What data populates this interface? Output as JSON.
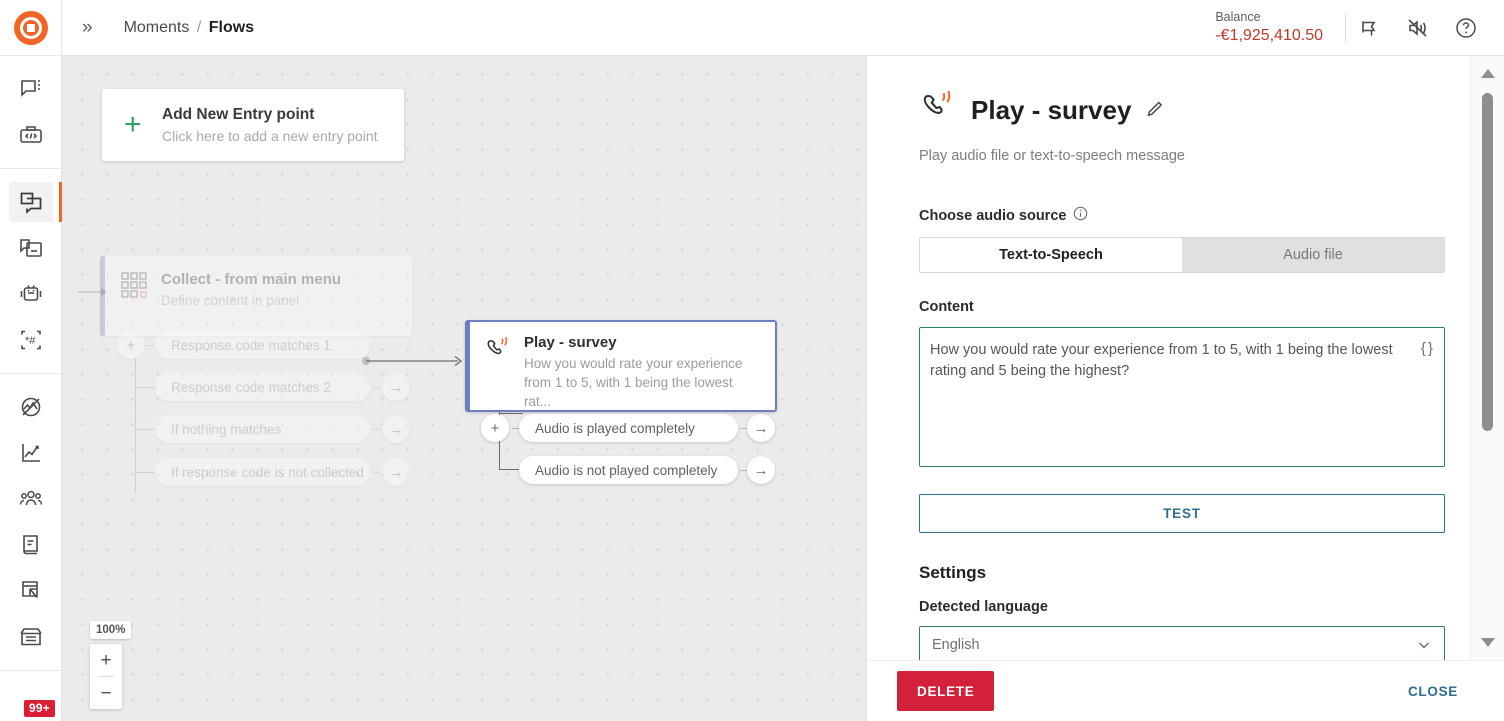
{
  "topbar": {
    "expand_icon": "chevron-double-right-icon",
    "breadcrumb_root": "Moments",
    "breadcrumb_sep": "/",
    "breadcrumb_current": "Flows",
    "balance_label": "Balance",
    "balance_value": "-€1,925,410.50",
    "balance_color": "#c0392b",
    "icons": [
      "announcement-icon",
      "mute-icon",
      "help-icon"
    ]
  },
  "rail": {
    "logo": "logo-icon",
    "groups": [
      {
        "items": [
          {
            "name": "conversations-icon",
            "active": false
          },
          {
            "name": "code-toolbox-icon",
            "active": false
          }
        ]
      },
      {
        "items": [
          {
            "name": "flows-icon",
            "active": true
          },
          {
            "name": "templates-icon",
            "active": false
          },
          {
            "name": "chatbot-icon",
            "active": false
          },
          {
            "name": "keywords-icon",
            "active": false
          }
        ]
      },
      {
        "items": [
          {
            "name": "pulse-icon",
            "active": false
          },
          {
            "name": "analytics-icon",
            "active": false
          },
          {
            "name": "audiences-icon",
            "active": false
          },
          {
            "name": "catalog-icon",
            "active": false
          },
          {
            "name": "landing-page-icon",
            "active": false
          },
          {
            "name": "storefront-icon",
            "active": false
          }
        ]
      }
    ],
    "badge": "99+",
    "badge_color": "#d81f34",
    "active_indicator_color": "#f26524"
  },
  "canvas": {
    "zoom_level": "100%",
    "zoom_in_label": "+",
    "zoom_out_label": "−",
    "entry_node": {
      "title": "Add New Entry point",
      "subtitle": "Click here to add a new entry point",
      "plus_label": "+",
      "plus_color": "#2e9e6b"
    },
    "collect_node": {
      "title": "Collect - from main menu",
      "subtitle": "Define content in panel",
      "icon": "keypad-icon",
      "accent_color": "#6d7fc4",
      "branches": [
        "Response code matches 1",
        "Response code matches 2",
        "If nothing matches",
        "If response code is not collected"
      ],
      "add_branch_label": "+"
    },
    "play_node": {
      "title": "Play - survey",
      "subtitle": "How you would rate your experience from 1 to 5, with 1 being the lowest rat...",
      "icon": "voice-call-icon",
      "accent_color": "#6d7fc4",
      "selected": true,
      "branches": [
        "Audio is played completely",
        "Audio is not played completely"
      ],
      "add_branch_label": "+"
    }
  },
  "panel": {
    "icon": "voice-call-icon",
    "title": "Play - survey",
    "edit_icon": "pencil-icon",
    "description": "Play audio file or text-to-speech message",
    "audio_source": {
      "label": "Choose audio source",
      "info_icon": "info-icon",
      "options": [
        "Text-to-Speech",
        "Audio file"
      ],
      "selected": "Text-to-Speech"
    },
    "content": {
      "label": "Content",
      "value": "How you would rate your experience from 1 to 5, with 1 being the lowest rating and 5 being the highest?",
      "variable_icon": "{ }",
      "border_color": "#2e7d63"
    },
    "test_button": "TEST",
    "test_color": "#2d6f90",
    "settings_heading": "Settings",
    "language": {
      "label": "Detected language",
      "value": "English",
      "caret_icon": "chevron-down-icon"
    },
    "footer": {
      "delete_label": "DELETE",
      "delete_color": "#d4213a",
      "close_label": "CLOSE",
      "close_color": "#2d6f90"
    }
  }
}
